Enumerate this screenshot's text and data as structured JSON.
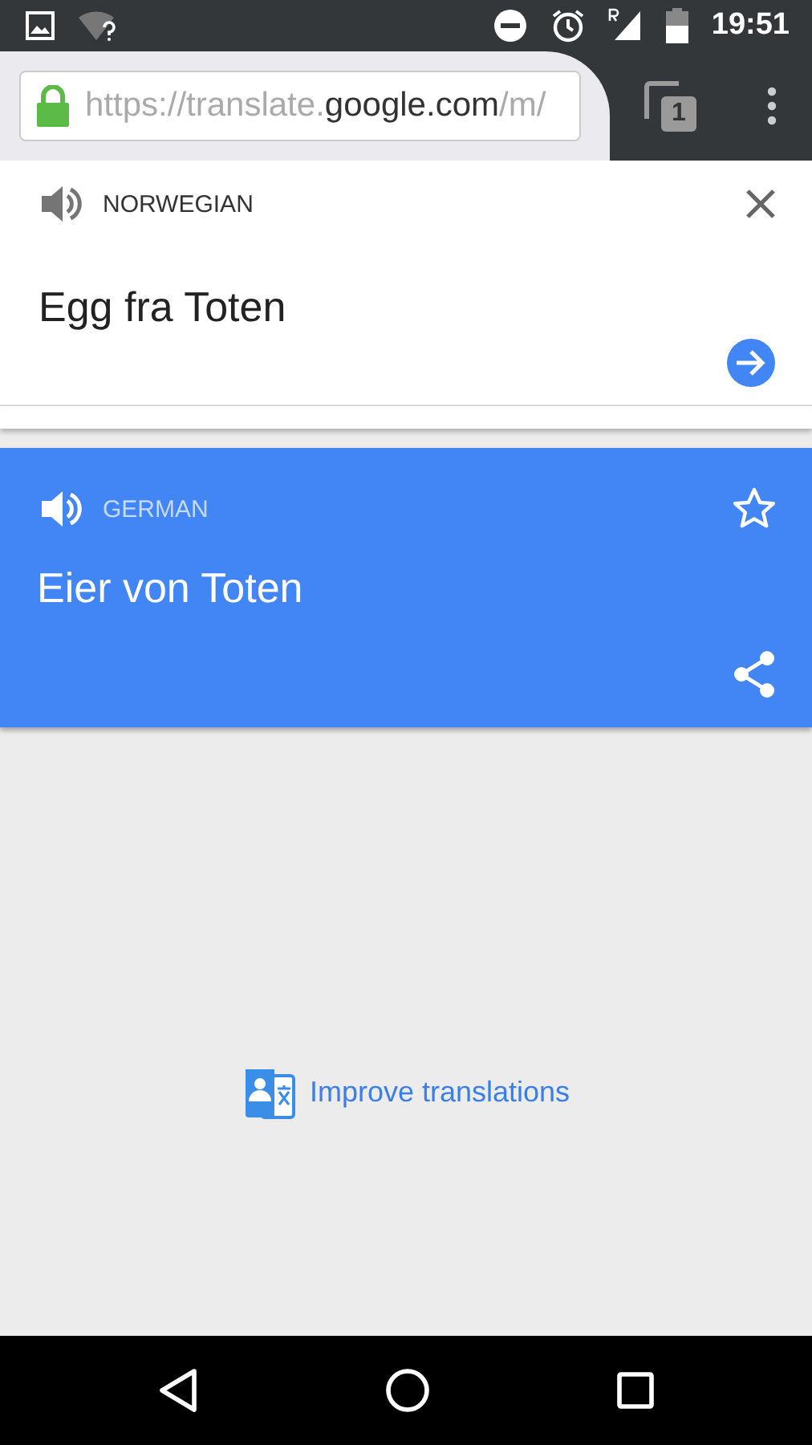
{
  "status_bar": {
    "time": "19:51"
  },
  "browser": {
    "url": {
      "scheme": "https://translate.",
      "host": "google.com",
      "path": "/m/"
    },
    "secure": true,
    "tab_count": "1"
  },
  "source": {
    "language": "NORWEGIAN",
    "text": "Egg fra Toten"
  },
  "result": {
    "language": "GERMAN",
    "text": "Eier von Toten",
    "starred": false
  },
  "footer_link": "Improve translations"
}
